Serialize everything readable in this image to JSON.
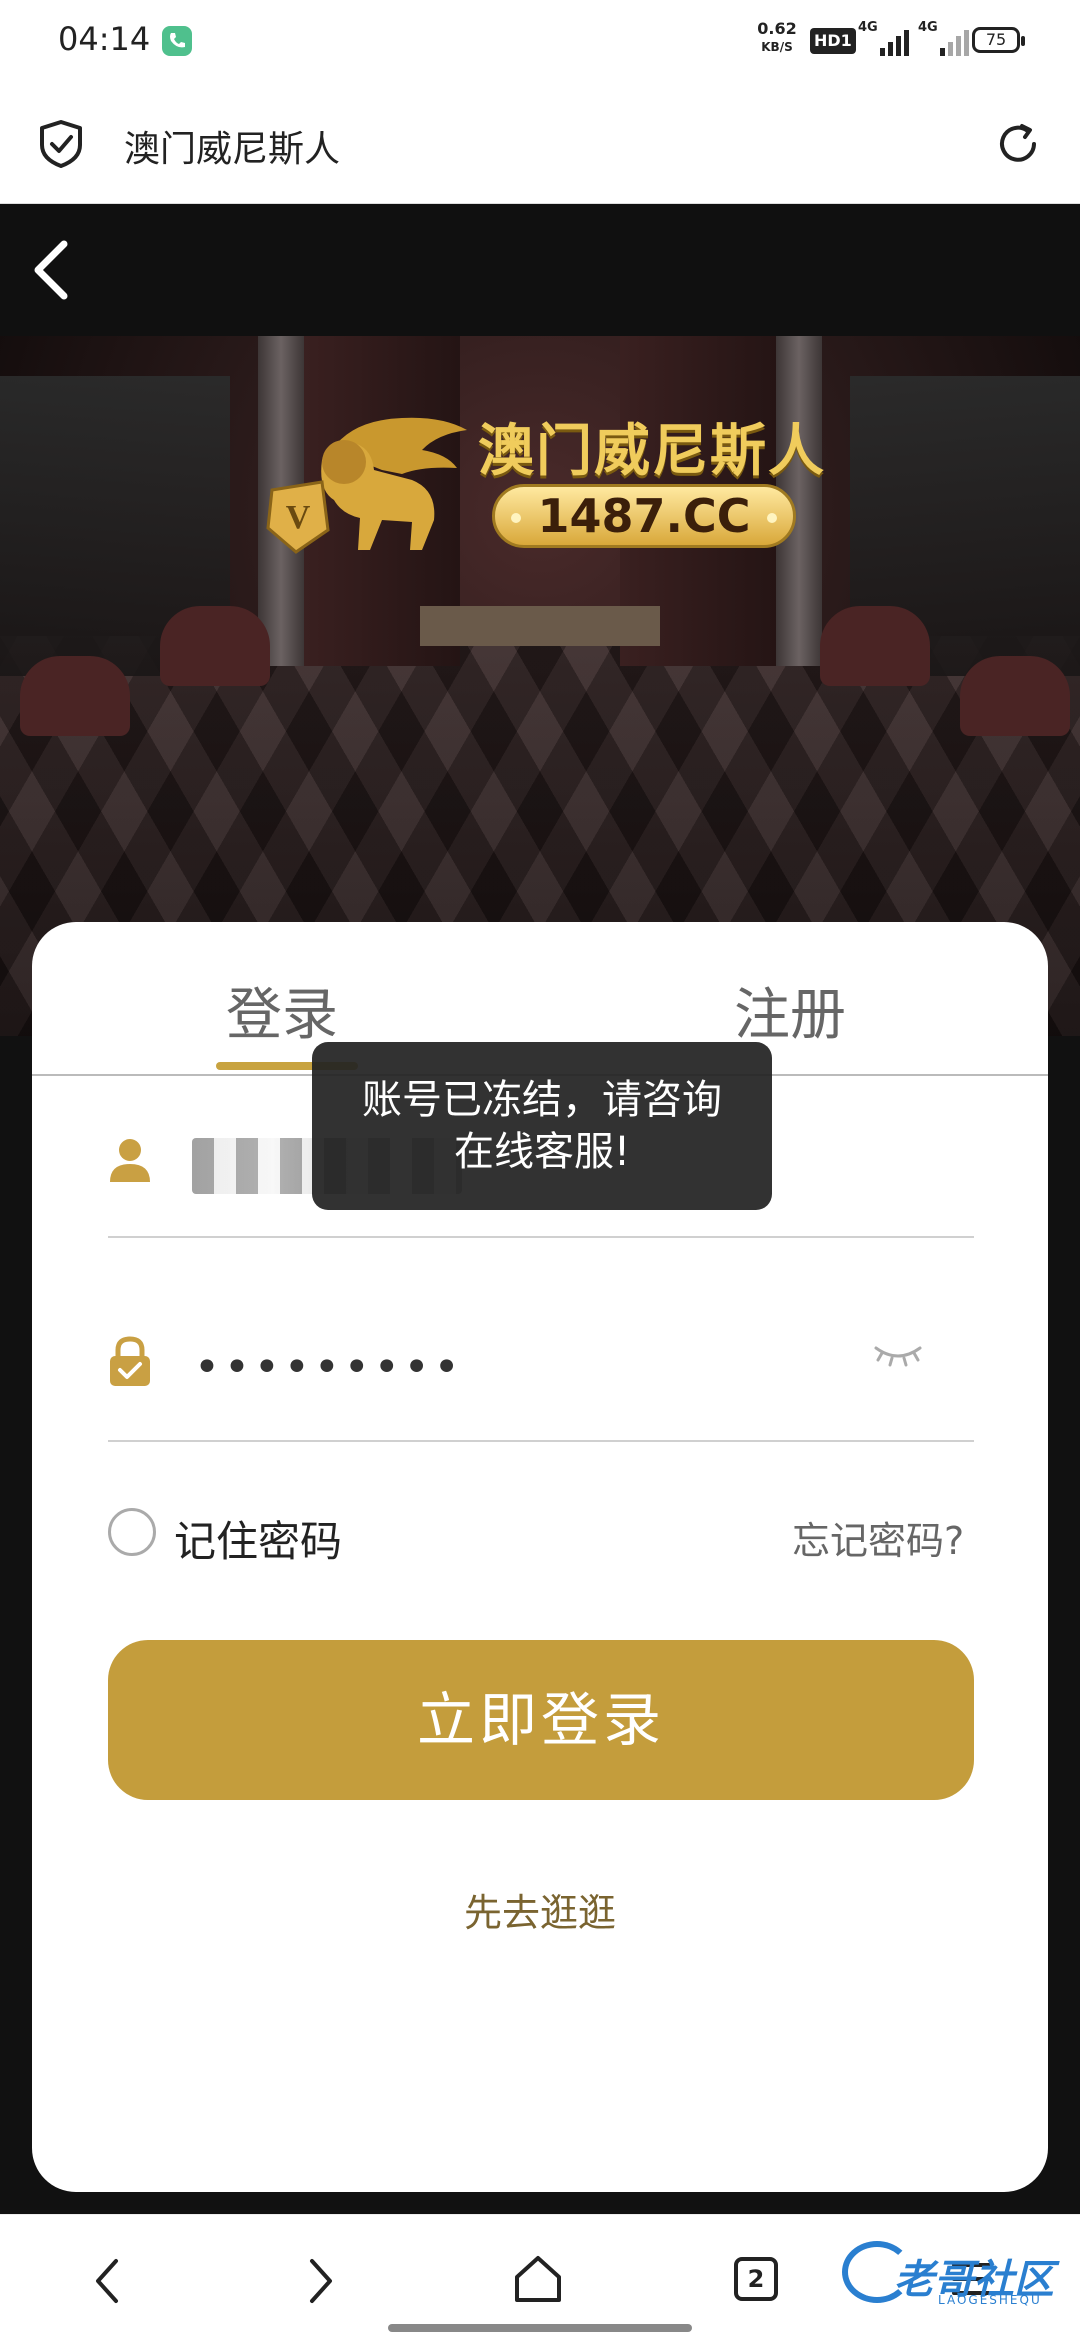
{
  "status_bar": {
    "time": "04:14",
    "net_speed": "0.62",
    "net_unit": "KB/S",
    "hd": "HD1",
    "signal_1": "4G",
    "signal_2": "4G",
    "battery": "75"
  },
  "browser": {
    "title": "澳门威尼斯人"
  },
  "hero": {
    "brand_name": "澳门威尼斯人",
    "domain": "1487.CC"
  },
  "login": {
    "tab_login": "登录",
    "tab_register": "注册",
    "password_mask": "•••••••••",
    "remember_label": "记住密码",
    "forgot_label": "忘记密码?",
    "submit_label": "立即登录",
    "browse_label": "先去逛逛"
  },
  "toast": {
    "line1": "账号已冻结，请咨询",
    "line2": "在线客服!"
  },
  "nav": {
    "tab_count": "2"
  },
  "watermark": {
    "text": "老哥社区",
    "sub": "LAOGESHEQU"
  },
  "colors": {
    "accent": "#c49d3c",
    "toast_bg": "#222222",
    "header_bg": "#101010"
  }
}
